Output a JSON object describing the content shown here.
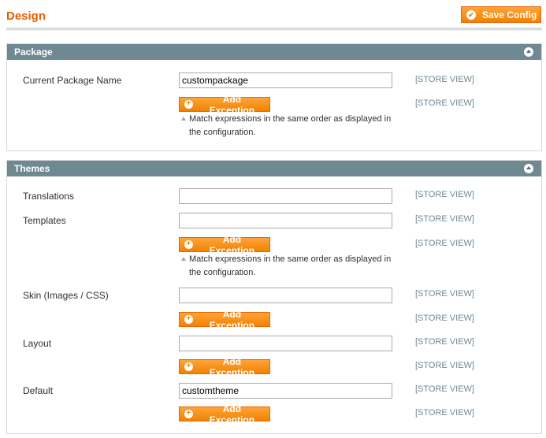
{
  "page": {
    "title": "Design",
    "save_label": "Save Config"
  },
  "colors": {
    "accent": "#eb5e00",
    "button": "#f18200",
    "section_header": "#6f8992"
  },
  "icons": {
    "save": "check-circle-icon",
    "add": "plus-circle-icon",
    "collapse": "chevron-up-icon",
    "note": "caret-up-icon"
  },
  "package": {
    "header": "Package",
    "fields": {
      "current_package": {
        "label": "Current Package Name",
        "value": "custompackage",
        "scope": "[STORE VIEW]"
      }
    },
    "exception": {
      "label": "Add Exception",
      "scope": "[STORE VIEW]"
    },
    "note": {
      "line1": "Match expressions in the same order as displayed in",
      "line2": "the configuration."
    }
  },
  "themes": {
    "header": "Themes",
    "translations": {
      "label": "Translations",
      "value": "",
      "scope": "[STORE VIEW]"
    },
    "templates": {
      "label": "Templates",
      "value": "",
      "scope": "[STORE VIEW]",
      "exception_label": "Add Exception",
      "exception_scope": "[STORE VIEW]"
    },
    "note": {
      "line1": "Match expressions in the same order as displayed in",
      "line2": "the configuration."
    },
    "skin": {
      "label": "Skin (Images / CSS)",
      "value": "",
      "scope": "[STORE VIEW]",
      "exception_label": "Add Exception",
      "exception_scope": "[STORE VIEW]"
    },
    "layout": {
      "label": "Layout",
      "value": "",
      "scope": "[STORE VIEW]",
      "exception_label": "Add Exception",
      "exception_scope": "[STORE VIEW]"
    },
    "default": {
      "label": "Default",
      "value": "customtheme",
      "scope": "[STORE VIEW]",
      "exception_label": "Add Exception",
      "exception_scope": "[STORE VIEW]"
    }
  }
}
